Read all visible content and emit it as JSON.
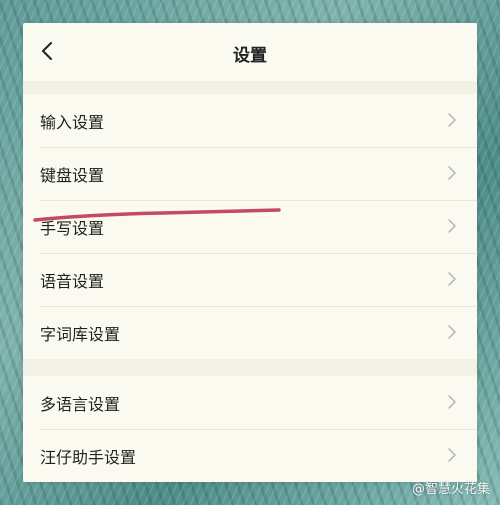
{
  "header": {
    "back_icon": "chevron-left-icon",
    "title": "设置"
  },
  "group1": [
    {
      "label": "输入设置"
    },
    {
      "label": "键盘设置"
    },
    {
      "label": "手写设置"
    },
    {
      "label": "语音设置"
    },
    {
      "label": "字词库设置"
    }
  ],
  "group2": [
    {
      "label": "多语言设置"
    },
    {
      "label": "汪仔助手设置"
    }
  ],
  "annotation": {
    "underline_color": "#c24a63"
  },
  "watermark": {
    "text": "@智慧火花集"
  }
}
